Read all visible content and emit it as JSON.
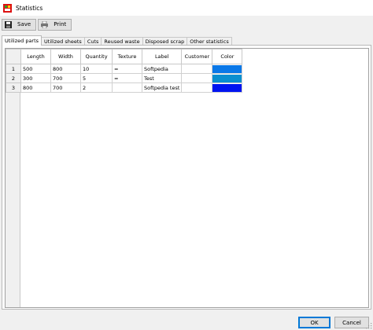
{
  "window": {
    "title": "Statistics"
  },
  "toolbar": {
    "save_label": "Save",
    "print_label": "Print"
  },
  "tabs": [
    {
      "label": "Utilized parts"
    },
    {
      "label": "Utilized sheets"
    },
    {
      "label": "Cuts"
    },
    {
      "label": "Reused waste"
    },
    {
      "label": "Disposed scrap"
    },
    {
      "label": "Other statistics"
    }
  ],
  "grid": {
    "columns": [
      "Length",
      "Width",
      "Quantity",
      "Texture",
      "Label",
      "Customer",
      "Color"
    ],
    "rows": [
      {
        "num": "1",
        "length": "500",
        "width": "800",
        "quantity": "10",
        "texture": "=",
        "label": "Softpedia",
        "customer": "",
        "color": "#0a78e8"
      },
      {
        "num": "2",
        "length": "300",
        "width": "700",
        "quantity": "5",
        "texture": "=",
        "label": "Test",
        "customer": "",
        "color": "#0a8fd0"
      },
      {
        "num": "3",
        "length": "800",
        "width": "700",
        "quantity": "2",
        "texture": "",
        "label": "Softpedia test",
        "customer": "",
        "color": "#0014f0"
      }
    ]
  },
  "footer": {
    "ok_label": "OK",
    "cancel_label": "Cancel"
  }
}
